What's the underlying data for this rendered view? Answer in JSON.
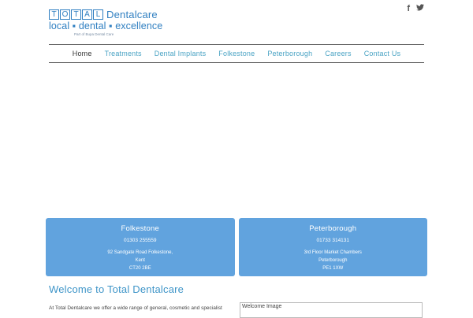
{
  "logo": {
    "total_letters": [
      "T",
      "O",
      "T",
      "A",
      "L"
    ],
    "dental": "Dentalcare",
    "tagline": "local ▪ dental ▪ excellence",
    "part_of": "Part of Bupa Dental Care"
  },
  "social": {
    "facebook": "f",
    "twitter": "t"
  },
  "nav": {
    "items": [
      "Home",
      "Treatments",
      "Dental Implants",
      "Folkestone",
      "Peterborough",
      "Careers",
      "Contact Us"
    ],
    "active": "Home"
  },
  "locations": [
    {
      "title": "Folkestone",
      "phone": "01303 255559",
      "address": [
        "92 Sandgate Road Folkestone,",
        "Kent",
        "CT20 2BE"
      ]
    },
    {
      "title": "Peterborough",
      "phone": "01733 314131",
      "address": [
        "3rd Floor Market Chambers",
        "Peterborough",
        "PE1 1XW"
      ]
    }
  ],
  "welcome": {
    "title": "Welcome to Total Dentalcare",
    "intro": "At Total Dentalcare we offer a wide range of general, cosmetic and specialist",
    "image_alt": "Welcome Image"
  },
  "colors": {
    "brand": "#2f7fc1",
    "nav_link": "#4aa3c4",
    "card_bg": "#61a3de"
  }
}
